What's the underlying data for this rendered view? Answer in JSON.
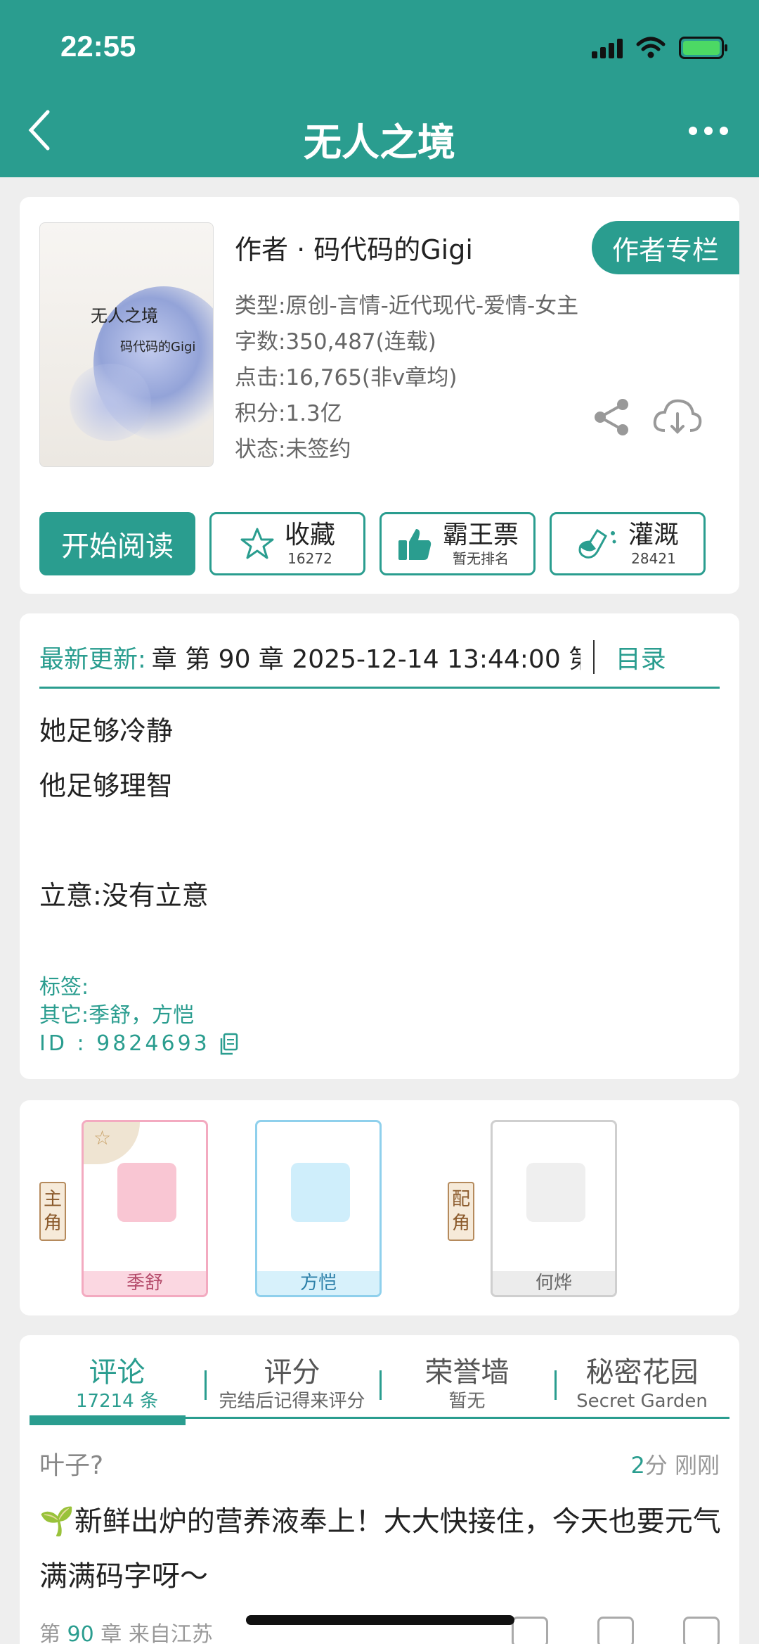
{
  "status_bar": {
    "time": "22:55"
  },
  "nav": {
    "title": "无人之境"
  },
  "book": {
    "cover_title": "无人之境",
    "cover_author": "码代码的Gigi",
    "author_line": "作者 · 码代码的Gigi",
    "author_column_button": "作者专栏",
    "info": [
      "类型:原创-言情-近代现代-爱情-女主",
      "字数:350,487(连载)",
      "点击:16,765(非v章均)",
      "积分:1.3亿",
      "状态:未签约"
    ],
    "actions": {
      "read": "开始阅读",
      "favorite_label": "收藏",
      "favorite_count": "16272",
      "vote_label": "霸王票",
      "vote_sub": "暂无排名",
      "water_label": "灌溉",
      "water_count": "28421"
    }
  },
  "update": {
    "label": "最新更新:",
    "text": "章 第 90 章 2025-12-14 13:44:00 第",
    "toc": "目录"
  },
  "intro": [
    "她足够冷静",
    "他足够理智",
    "",
    "立意:没有立意"
  ],
  "tags": {
    "tag_line": "标签:",
    "other_line": "其它:季舒，方恺",
    "id_line": "ID  :  9824693"
  },
  "characters": {
    "main_tag": [
      "主",
      "角"
    ],
    "support_tag": [
      "配",
      "角"
    ],
    "list": [
      {
        "name": "季舒",
        "style": "pink"
      },
      {
        "name": "方恺",
        "style": "blue"
      },
      {
        "name": "何烨",
        "style": "gray"
      }
    ]
  },
  "comments": {
    "tabs": [
      {
        "title": "评论",
        "sub": "17214 条"
      },
      {
        "title": "评分",
        "sub": "完结后记得来评分"
      },
      {
        "title": "荣誉墙",
        "sub": "暂无"
      },
      {
        "title": "秘密花园",
        "sub": "Secret Garden"
      }
    ],
    "item": {
      "user": "叶子?",
      "score": "2",
      "score_unit": "分",
      "time": "刚刚",
      "body": "新鲜出炉的营养液奉上！大大快接住，今天也要元气满满码字呀～",
      "foot_prefix": "第",
      "chapter": "90",
      "foot_suffix": "章 来自江苏"
    }
  },
  "colors": {
    "accent": "#2a9d8f"
  }
}
